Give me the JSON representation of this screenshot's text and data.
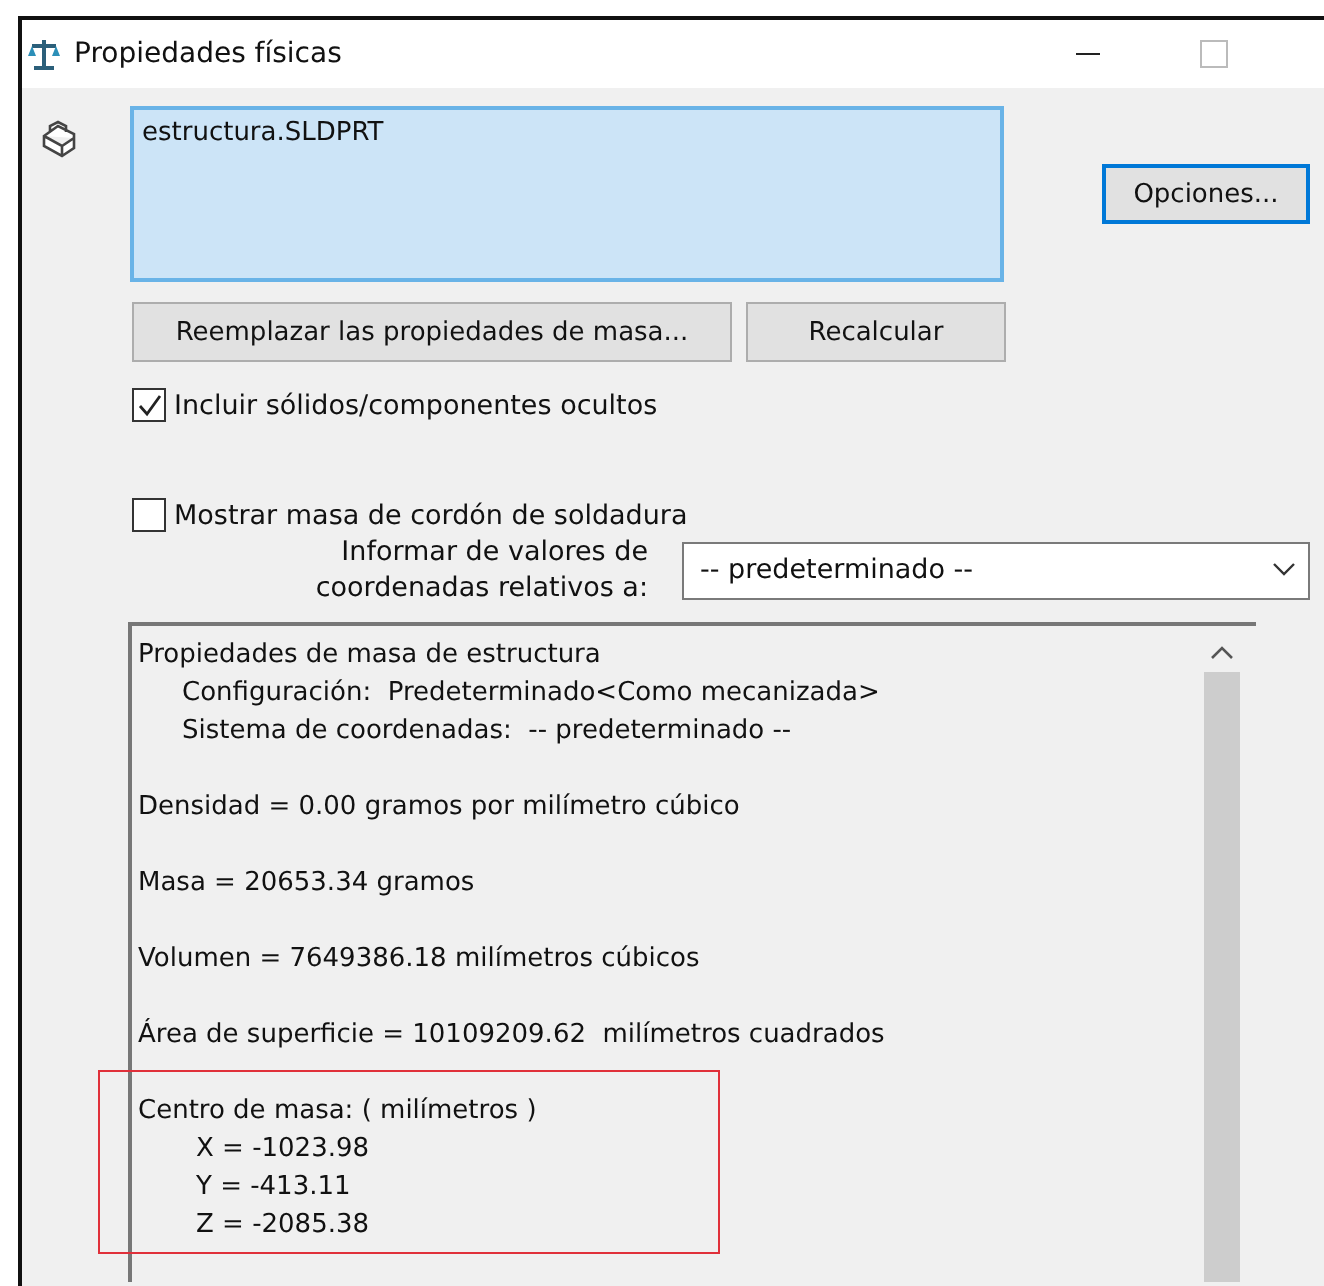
{
  "window": {
    "title": "Propiedades físicas"
  },
  "selection": {
    "items": [
      "estructura.SLDPRT"
    ]
  },
  "buttons": {
    "options": "Opciones...",
    "override": "Reemplazar las propiedades de masa...",
    "recalculate": "Recalcular"
  },
  "checkboxes": [
    {
      "label": "Incluir sólidos/componentes ocultos",
      "checked": true
    },
    {
      "label": "Mostrar masa de cordón de soldadura",
      "checked": false
    }
  ],
  "coordinates": {
    "label_lines": [
      "Informar de valores de",
      "coordenadas relativos a:"
    ],
    "value": "-- predeterminado --"
  },
  "results": [
    {
      "highlighted": false,
      "lines": [
        {
          "kind": "heading",
          "text": "Propiedades de masa de estructura"
        },
        {
          "kind": "sub",
          "text": "Configuración:  Predeterminado<Como mecanizada>"
        },
        {
          "kind": "sub",
          "text": "Sistema de coordenadas:  -- predeterminado --"
        }
      ]
    },
    {
      "highlighted": false,
      "lines": [
        {
          "kind": "heading",
          "text": "Densidad = 0.00 gramos por milímetro cúbico"
        }
      ]
    },
    {
      "highlighted": false,
      "lines": [
        {
          "kind": "heading",
          "text": "Masa = 20653.34 gramos"
        }
      ]
    },
    {
      "highlighted": false,
      "lines": [
        {
          "kind": "heading",
          "text": "Volumen = 7649386.18 milímetros cúbicos"
        }
      ]
    },
    {
      "highlighted": false,
      "lines": [
        {
          "kind": "heading",
          "text": "Área de superficie = 10109209.62  milímetros cuadrados"
        }
      ]
    },
    {
      "highlighted": true,
      "lines": [
        {
          "kind": "heading",
          "text": "Centro de masa: ( milímetros )"
        },
        {
          "kind": "coord",
          "text": "X = -1023.98"
        },
        {
          "kind": "coord",
          "text": "Y = -413.11"
        },
        {
          "kind": "coord",
          "text": "Z = -2085.38"
        }
      ]
    }
  ]
}
